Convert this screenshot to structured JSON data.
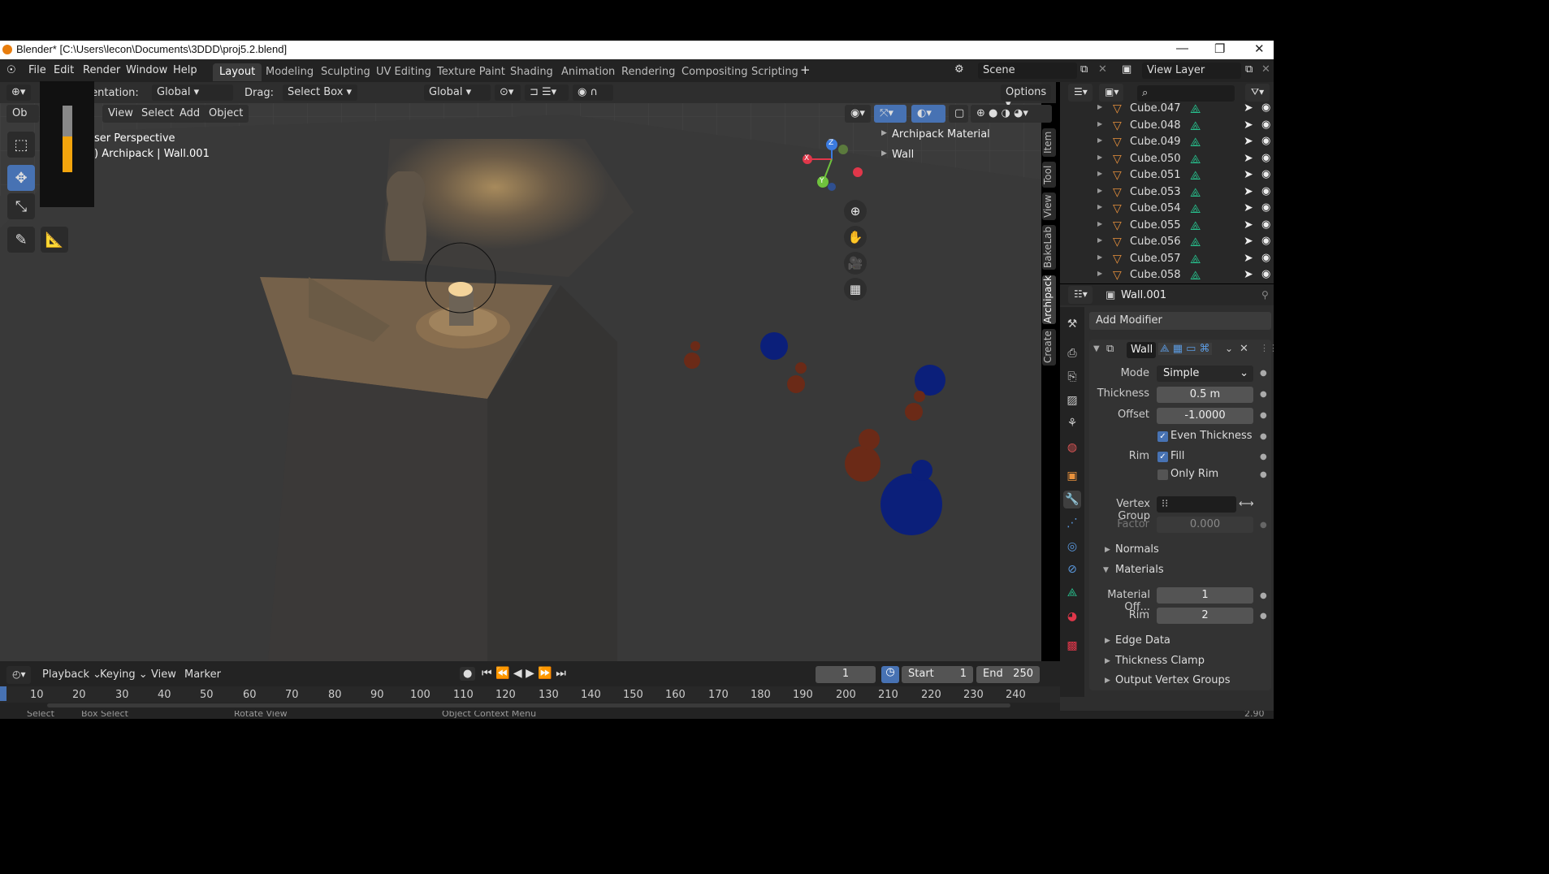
{
  "window": {
    "title": "Blender* [C:\\Users\\lecon\\Documents\\3DDD\\proj5.2.blend]",
    "controls": [
      "—",
      "❐",
      "✕"
    ]
  },
  "menu": [
    "File",
    "Edit",
    "Render",
    "Window",
    "Help"
  ],
  "workspaces": [
    "Layout",
    "Modeling",
    "Sculpting",
    "UV Editing",
    "Texture Paint",
    "Shading",
    "Animation",
    "Rendering",
    "Compositing",
    "Scripting"
  ],
  "active_workspace": "Layout",
  "scene": {
    "scene_name": "Scene",
    "view_layer": "View Layer"
  },
  "viewport_header": {
    "orientation_label": "Orientation:",
    "orientation_value": "Global",
    "drag_label": "Drag:",
    "drag_value": "Select Box",
    "transform_orientation": "Global",
    "options": "Options",
    "mode": "Ob",
    "menus": [
      "View",
      "Select",
      "Add",
      "Object"
    ]
  },
  "viewport_overlay": {
    "perspective": "ser Perspective",
    "context": ") Archipack | Wall.001"
  },
  "n_panel": {
    "items": [
      "Archipack Material",
      "Wall"
    ],
    "tabs": [
      "Item",
      "Tool",
      "View",
      "BakeLab",
      "Archipack",
      "Create"
    ],
    "active_tab": "Archipack"
  },
  "gizmo": {
    "x": "X",
    "y": "Y",
    "z": "Z"
  },
  "outliner": {
    "items": [
      "Cube.047",
      "Cube.048",
      "Cube.049",
      "Cube.050",
      "Cube.051",
      "Cube.053",
      "Cube.054",
      "Cube.055",
      "Cube.056",
      "Cube.057",
      "Cube.058"
    ]
  },
  "properties": {
    "object_name": "Wall.001",
    "add_modifier": "Add Modifier",
    "modifier_name": "Wall",
    "mode_label": "Mode",
    "mode_value": "Simple",
    "thickness_label": "Thickness",
    "thickness_value": "0.5 m",
    "offset_label": "Offset",
    "offset_value": "-1.0000",
    "even_thickness": "Even Thickness",
    "rim_label": "Rim",
    "fill": "Fill",
    "only_rim": "Only Rim",
    "vertex_group_label": "Vertex Group",
    "factor_label": "Factor",
    "factor_value": "0.000",
    "normals": "Normals",
    "materials": "Materials",
    "material_offset_label": "Material Off...",
    "material_offset_value": "1",
    "material_rim_label": "Rim",
    "material_rim_value": "2",
    "edge_data": "Edge Data",
    "thickness_clamp": "Thickness Clamp",
    "output_vertex_groups": "Output Vertex Groups"
  },
  "timeline": {
    "menus": [
      "Playback",
      "Keying",
      "View",
      "Marker"
    ],
    "current_frame": "1",
    "start_label": "Start",
    "start_value": "1",
    "end_label": "End",
    "end_value": "250",
    "ruler": [
      "10",
      "20",
      "30",
      "40",
      "50",
      "60",
      "70",
      "80",
      "90",
      "100",
      "110",
      "120",
      "130",
      "140",
      "150",
      "160",
      "170",
      "180",
      "190",
      "200",
      "210",
      "220",
      "230",
      "240"
    ]
  },
  "status_bar": [
    "Select",
    "Box Select",
    "Rotate View",
    "Object Context Menu",
    "2.90"
  ]
}
